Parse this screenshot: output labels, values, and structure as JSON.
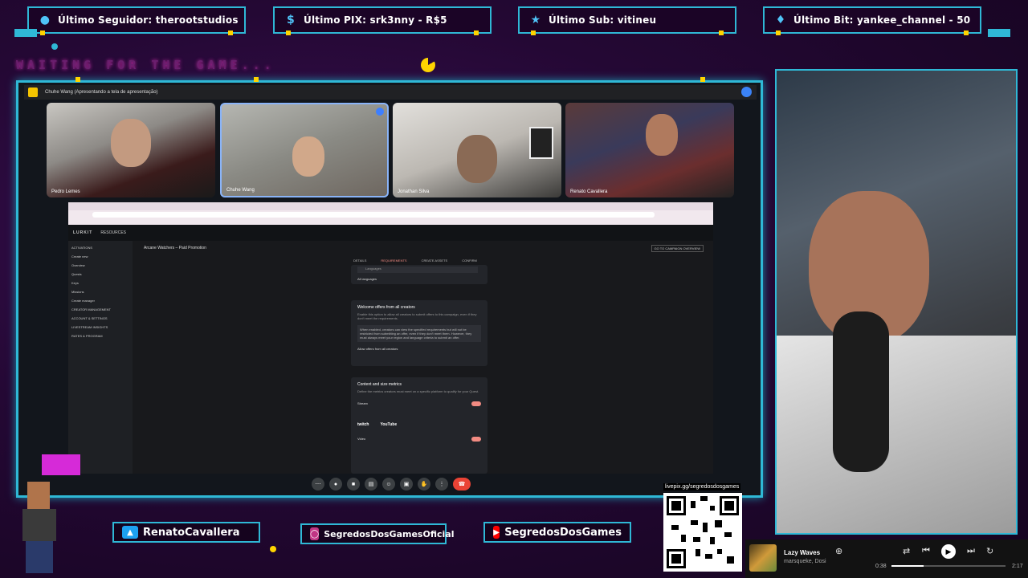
{
  "alerts": {
    "follower": "Último Seguidor: therootstudios",
    "pix": "Último PIX: srk3nny - R$5",
    "sub": "Último Sub: vitineu",
    "bit": "Último Bit: yankee_channel - 50"
  },
  "waiting_text": "WAITING FOR THE GAME...",
  "meet": {
    "presenter_text": "Chuhe Wang (Apresentando a tela de apresentação)",
    "participants": [
      {
        "name": "Pedro Lemes"
      },
      {
        "name": "Chuhe Wang"
      },
      {
        "name": "Jonathan Silva"
      },
      {
        "name": "Renato Cavallera"
      }
    ]
  },
  "shared_screen": {
    "app_brand": "LURKIT",
    "app_nav": "RESOURCES",
    "campaign_title": "Arcane Watchers – Paid Promotion",
    "back_button": "GO TO CAMPAIGN OVERVIEW",
    "sidebar": [
      "ACTIVATIONS",
      "Create new",
      "Overview",
      "Quests",
      "Keys",
      "Missions",
      "Create manager",
      "CREATOR MANAGEMENT",
      "ACCOUNT & SETTINGS",
      "LIVESTREAM INSIGHTS",
      "RATES & PROGRAM"
    ],
    "steps": [
      "DETAILS",
      "REQUIREMENTS",
      "CREATE ASSETS",
      "CONFIRM"
    ],
    "search_placeholder": "Languages",
    "all_languages": "All languages",
    "welcome_title": "Welcome offers from all creators",
    "welcome_desc": "Enable this option to allow all creators to submit offers to this campaign, even if they don't meet the requirements.",
    "welcome_note": "When enabled, creators can view the specified requirements but will not be restricted from submitting an offer, even if they don't meet them. However, they must always meet your region and language criteria to submit an offer.",
    "allow_offers": "Allow offers from all creators",
    "content_title": "Content and size metrics",
    "content_desc": "Define the metrics creators must meet on a specific platform to qualify for your Quest.",
    "stream_label": "Stream",
    "video_label": "Video",
    "platforms": [
      "twitch",
      "YouTube"
    ]
  },
  "socials": {
    "twitter": "RenatoCavallera",
    "instagram": "SegredosDosGamesOficial",
    "youtube": "SegredosDosGames"
  },
  "qr_url": "livepix.gg/segredosdosgames",
  "player": {
    "title": "Lazy Waves",
    "artist": "marsqueke, Dosi",
    "elapsed": "0:38",
    "total": "2:17",
    "progress": 0.28
  }
}
